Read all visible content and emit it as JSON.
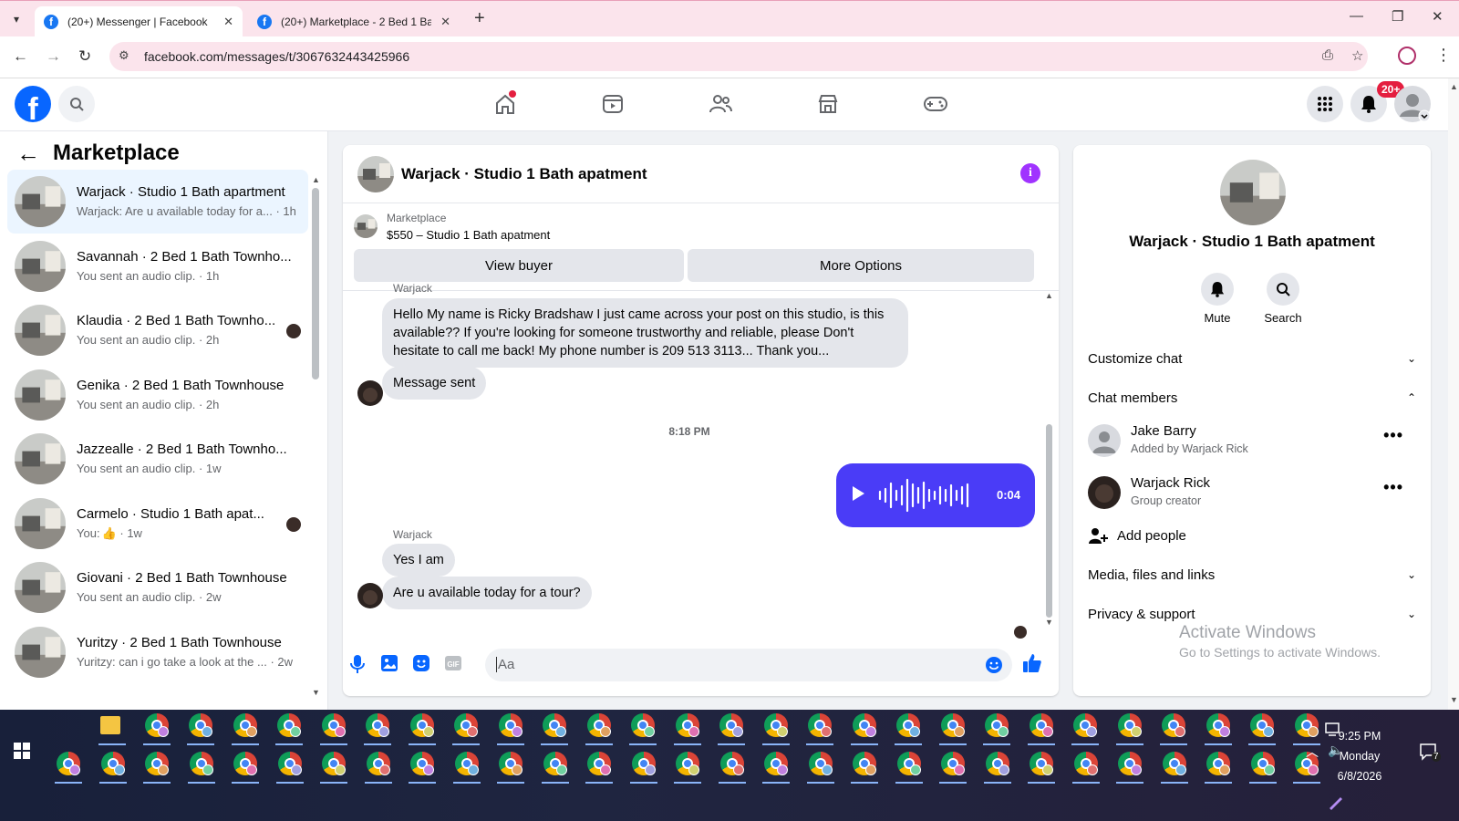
{
  "browser": {
    "tabs": [
      {
        "title": "(20+) Messenger | Facebook",
        "active": true
      },
      {
        "title": "(20+) Marketplace - 2 Bed 1 Bath",
        "active": false
      }
    ],
    "url": "facebook.com/messages/t/3067632443425966"
  },
  "fb_header": {
    "logo": "f",
    "notif_badge": "20+",
    "nav_icons": [
      "home-icon",
      "video-icon",
      "friends-icon",
      "marketplace-icon",
      "gaming-icon"
    ]
  },
  "sidebar": {
    "title": "Marketplace",
    "conversations": [
      {
        "title": "Warjack · Studio 1 Bath apartment",
        "preview": "Warjack: Are u available today for a...",
        "time": "1h",
        "active": true
      },
      {
        "title": "Savannah · 2 Bed 1 Bath Townho...",
        "preview": "You sent an audio clip.",
        "time": "1h"
      },
      {
        "title": "Klaudia · 2 Bed 1 Bath Townho...",
        "preview": "You sent an audio clip.",
        "time": "2h",
        "seen": true
      },
      {
        "title": "Genika · 2 Bed 1 Bath Townhouse",
        "preview": "You sent an audio clip.",
        "time": "2h"
      },
      {
        "title": "Jazzealle · 2 Bed 1 Bath Townho...",
        "preview": "You sent an audio clip.",
        "time": "1w"
      },
      {
        "title": "Carmelo · Studio 1 Bath apat...",
        "preview": "You:",
        "time": "1w",
        "seen": true,
        "like": true
      },
      {
        "title": "Giovani · 2 Bed 1 Bath Townhouse",
        "preview": "You sent an audio clip.",
        "time": "2w"
      },
      {
        "title": "Yuritzy · 2 Bed 1 Bath Townhouse",
        "preview": "Yuritzy: can i go take a look at the ...",
        "time": "2w"
      }
    ]
  },
  "chat": {
    "title": "Warjack · Studio 1 Bath apatment",
    "marketplace_label": "Marketplace",
    "listing": "$550 – Studio 1 Bath apatment",
    "view_buyer": "View buyer",
    "more_options": "More Options",
    "messages": {
      "sender_top": "Warjack",
      "long_msg": "Hello My name is Ricky Bradshaw I just came across your post on this studio, is this available?? If you're looking for someone trustworthy and reliable, please Don't hesitate to call me back! My phone number is 209 513 3113... Thank you...",
      "msg_sent": "Message sent",
      "timestamp": "8:18 PM",
      "audio_duration": "0:04",
      "sender_bottom": "Warjack",
      "reply1": "Yes I am",
      "reply2": "Are u available today for a tour?"
    },
    "composer_placeholder": "Aa"
  },
  "info_panel": {
    "name": "Warjack · Studio 1 Bath apatment",
    "mute": "Mute",
    "search": "Search",
    "customize_chat": "Customize chat",
    "chat_members": "Chat members",
    "members": [
      {
        "name": "Jake Barry",
        "sub": "Added by Warjack Rick"
      },
      {
        "name": "Warjack Rick",
        "sub": "Group creator"
      }
    ],
    "add_people": "Add people",
    "media_files": "Media, files and links",
    "privacy_support": "Privacy & support",
    "activate_line1": "Activate Windows",
    "activate_line2": "Go to Settings to activate Windows."
  },
  "taskbar": {
    "time": "9:25 PM",
    "day": "Monday",
    "date": "6/8/2026",
    "notification_count": "7"
  },
  "colors": {
    "fb_blue": "#0866ff",
    "audio_bubble": "#4a3cf7",
    "info_purple": "#a033ff",
    "badge_red": "#e41e3f"
  }
}
